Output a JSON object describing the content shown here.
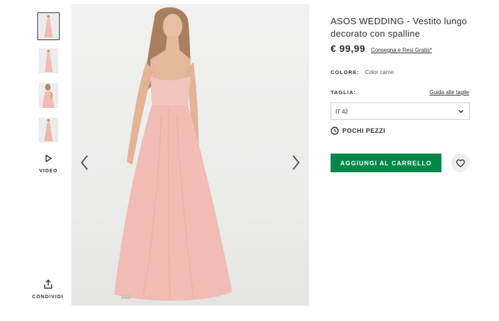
{
  "thumbnails": [
    {
      "alt": "front",
      "active": true
    },
    {
      "alt": "side",
      "active": false
    },
    {
      "alt": "back",
      "active": false
    },
    {
      "alt": "full",
      "active": false
    }
  ],
  "video": {
    "label": "VIDEO",
    "icon": "play-icon"
  },
  "share": {
    "label": "CONDIVIDI",
    "icon": "share-icon"
  },
  "gallery": {
    "prev_icon": "chevron-left-icon",
    "next_icon": "chevron-right-icon"
  },
  "product": {
    "title": "ASOS WEDDING - Vestito lungo decorato con spalline",
    "price": "€ 99,99",
    "delivery_link": "Consegna e Resi Gratis*",
    "color_label": "COLORE:",
    "color_value": "Color carne",
    "size_label": "TAGLIA:",
    "size_guide": "Guida alle taglie",
    "size_selected": "IT 42",
    "stock_status": "POCHI PEZZI",
    "add_to_cart": "AGGIUNGI AL CARRELLO"
  },
  "colors": {
    "accent_green": "#018849",
    "text": "#2d2d2d",
    "dress": "#f0bcb4"
  }
}
